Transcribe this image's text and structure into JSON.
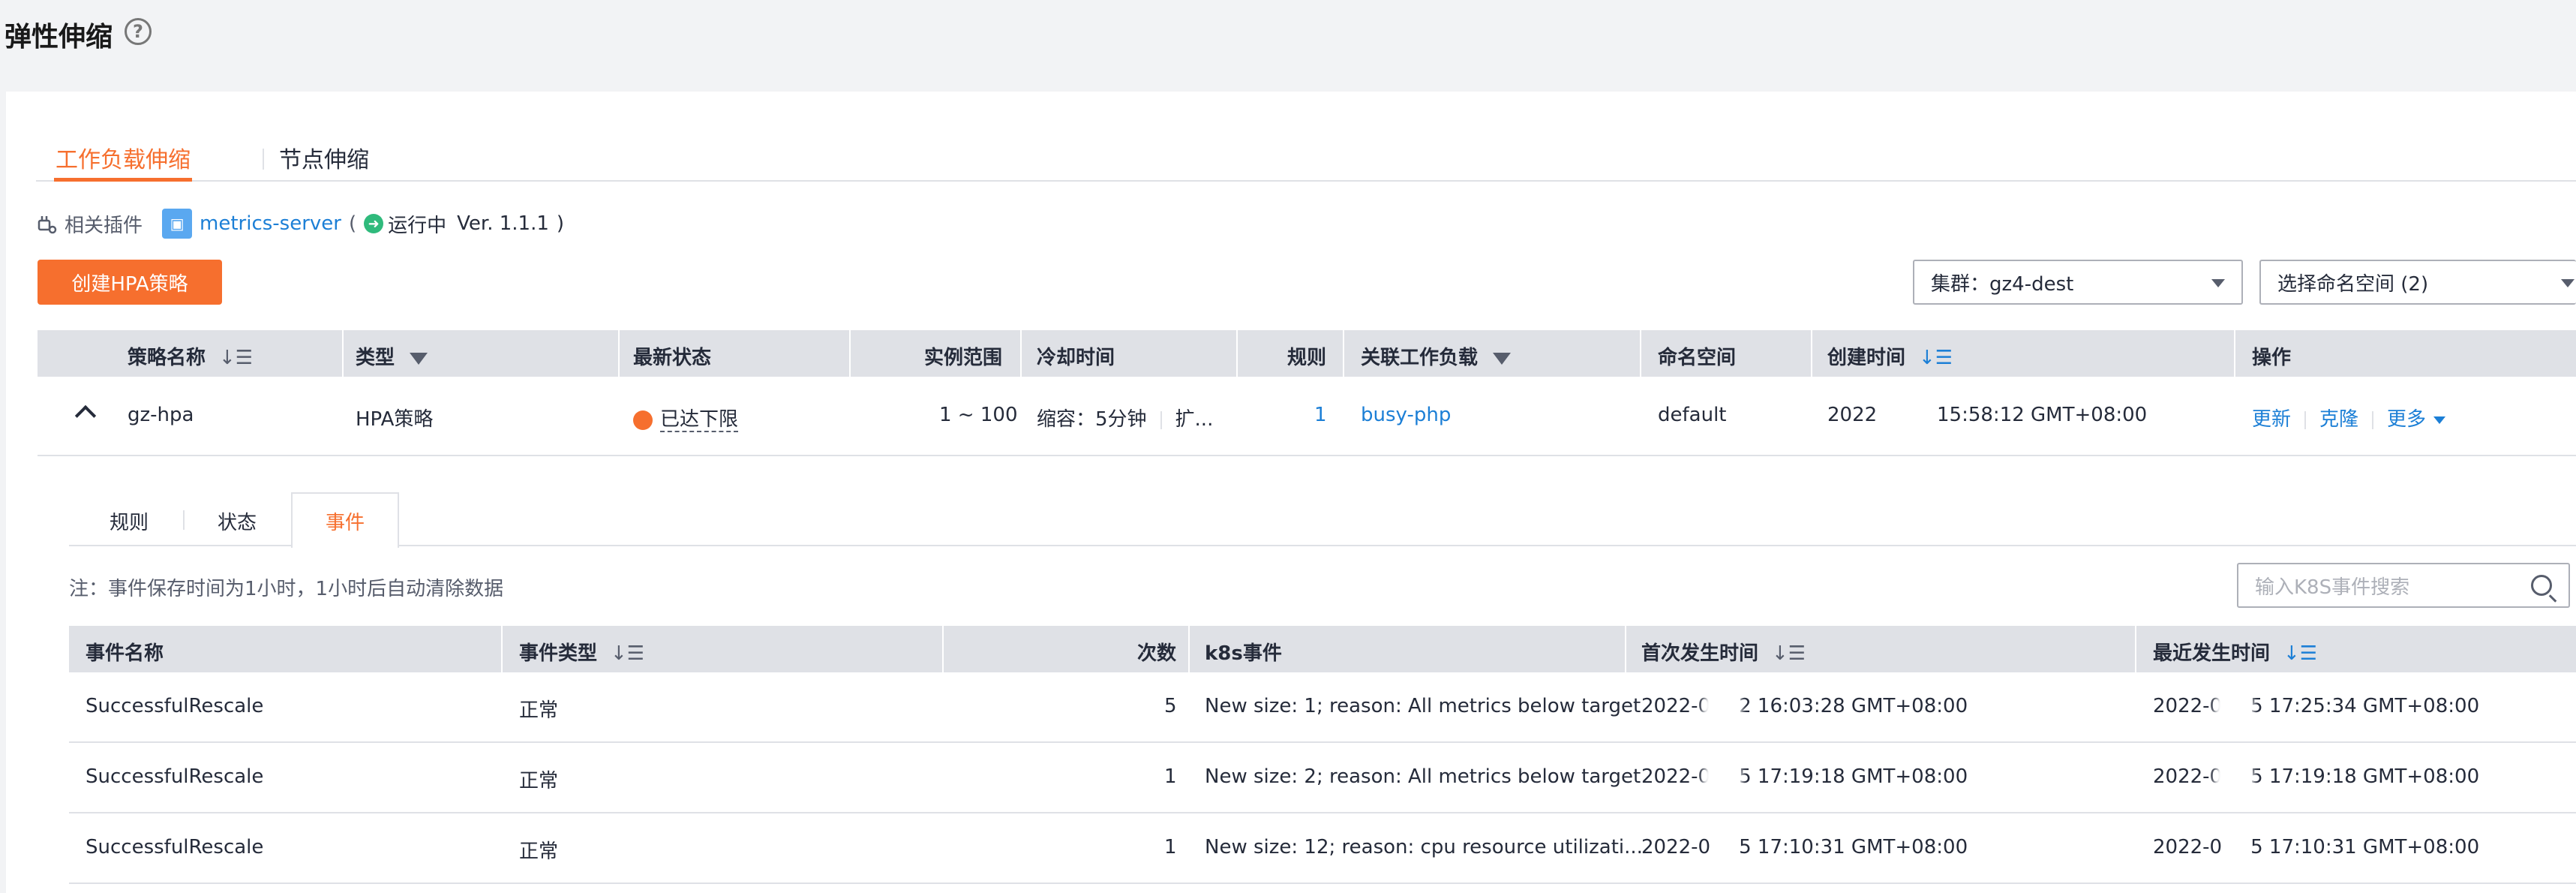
{
  "page": {
    "title": "弹性伸缩",
    "help_icon": "?"
  },
  "main_tabs": [
    {
      "label": "工作负载伸缩",
      "active": true
    },
    {
      "label": "节点伸缩",
      "active": false
    }
  ],
  "plugin": {
    "label": "相关插件",
    "server_icon": "▣",
    "name": "metrics-server",
    "open_paren": "(",
    "run_icon": "➜",
    "status": "运行中",
    "version": "Ver. 1.1.1",
    "close_paren": ")"
  },
  "toolbar": {
    "create_label": "创建HPA策略",
    "cluster_select": "集群：gz4-dest",
    "namespace_select": "选择命名空间 (2)"
  },
  "policy_table": {
    "headers": {
      "name": "策略名称",
      "type": "类型",
      "status": "最新状态",
      "range": "实例范围",
      "cooldown": "冷却时间",
      "rules": "规则",
      "workload": "关联工作负载",
      "namespace": "命名空间",
      "created": "创建时间",
      "actions": "操作"
    },
    "row": {
      "name": "gz-hpa",
      "type": "HPA策略",
      "status_icon": "◷",
      "status": "已达下限",
      "range": "1 ~ 100",
      "cooldown_a": "缩容：5分钟",
      "cooldown_b": "扩...",
      "rules": "1",
      "workload": "busy-php",
      "namespace": "default",
      "created_year": "2022",
      "created_time": "15:58:12 GMT+08:00",
      "action_update": "更新",
      "action_clone": "克隆",
      "action_more": "更多"
    }
  },
  "sub_tabs": [
    {
      "label": "规则"
    },
    {
      "label": "状态"
    },
    {
      "label": "事件",
      "active": true
    }
  ],
  "events": {
    "note": "注：事件保存时间为1小时，1小时后自动清除数据",
    "search_placeholder": "输入K8S事件搜索",
    "headers": {
      "name": "事件名称",
      "type": "事件类型",
      "count": "次数",
      "k8s": "k8s事件",
      "first": "首次发生时间",
      "last": "最近发生时间"
    },
    "rows": [
      {
        "name": "SuccessfulRescale",
        "type": "正常",
        "count": "5",
        "k8s": "New size: 1; reason: All metrics below target",
        "first_a": "2022-0",
        "first_b": "2 16:03:28 GMT+08:00",
        "last_a": "2022-0",
        "last_b": "5 17:25:34 GMT+08:00"
      },
      {
        "name": "SuccessfulRescale",
        "type": "正常",
        "count": "1",
        "k8s": "New size: 2; reason: All metrics below target",
        "first_a": "2022-0",
        "first_b": "5 17:19:18 GMT+08:00",
        "last_a": "2022-0",
        "last_b": "5 17:19:18 GMT+08:00"
      },
      {
        "name": "SuccessfulRescale",
        "type": "正常",
        "count": "1",
        "k8s": "New size: 12; reason: cpu resource utilizati...",
        "first_a": "2022-0",
        "first_b": "5 17:10:31 GMT+08:00",
        "last_a": "2022-0",
        "last_b": "5 17:10:31 GMT+08:00"
      }
    ]
  }
}
